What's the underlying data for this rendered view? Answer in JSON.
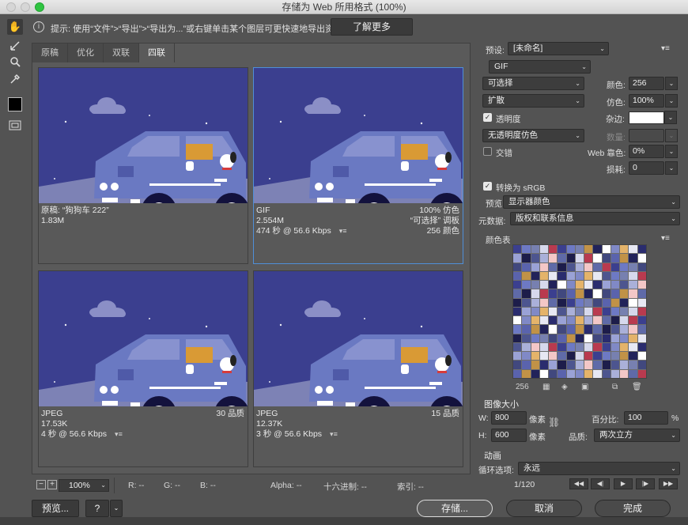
{
  "window": {
    "title": "存储为 Web 所用格式 (100%)"
  },
  "tools": [
    {
      "icon": "hand-icon"
    },
    {
      "icon": "slice-select-icon"
    },
    {
      "icon": "zoom-icon"
    },
    {
      "icon": "eyedropper-icon"
    },
    {
      "icon": "eyedropper-color-swatch"
    },
    {
      "icon": "toggle-slices-icon"
    }
  ],
  "hint": {
    "text": "提示: 使用“文件”>“导出”>“导出为...”或右键单击某个图层可更快速地导出资源",
    "learn_more": "了解更多"
  },
  "tabs": [
    "原稿",
    "优化",
    "双联",
    "四联"
  ],
  "active_tab": "四联",
  "panes": [
    {
      "left": "原稿: “狗狗车 222”",
      "left2": "1.83M",
      "left3": "",
      "right": "",
      "right2": "",
      "right3": ""
    },
    {
      "left": "GIF",
      "left2": "2.554M",
      "left3": "474 秒 @ 56.6 Kbps",
      "right": "100% 仿色",
      "right2": "“可选择” 调板",
      "right3": "256 颜色"
    },
    {
      "left": "JPEG",
      "left2": "17.53K",
      "left3": "4 秒 @ 56.6 Kbps",
      "right": "30 品质",
      "right2": "",
      "right3": ""
    },
    {
      "left": "JPEG",
      "left2": "12.37K",
      "left3": "3 秒 @ 56.6 Kbps",
      "right": "15 品质",
      "right2": "",
      "right3": ""
    }
  ],
  "status": {
    "zoom": "100%",
    "r": "R: --",
    "g": "G: --",
    "b": "B: --",
    "alpha": "Alpha: --",
    "hex": "十六进制: --",
    "index": "索引: --"
  },
  "settings": {
    "preset_label": "预设:",
    "preset_value": "[未命名]",
    "format": "GIF",
    "reduction": "可选择",
    "colors_label": "颜色:",
    "colors_value": "256",
    "dither_method": "扩散",
    "dither_label": "仿色:",
    "dither_value": "100%",
    "transparency_label": "透明度",
    "transparency_checked": true,
    "matte_label": "杂边:",
    "matte_color": "#ffffff",
    "transparency_dither": "无透明度仿色",
    "amount_label": "数量:",
    "interlaced_label": "交错",
    "interlaced_checked": false,
    "websnap_label": "Web 靠色:",
    "websnap_value": "0%",
    "lossy_label": "损耗:",
    "lossy_value": "0",
    "srgb_label": "转换为 sRGB",
    "srgb_checked": true,
    "preview_label": "预览:",
    "preview_value": "显示器颜色",
    "metadata_label": "元数据:",
    "metadata_value": "版权和联系信息",
    "color_table_label": "颜色表",
    "color_count": "256",
    "image_size_label": "图像大小",
    "w_label": "W:",
    "w_value": "800",
    "h_label": "H:",
    "h_value": "600",
    "px_unit": "像素",
    "percent_label": "百分比:",
    "percent_value": "100",
    "percent_unit": "%",
    "quality_label": "品质:",
    "quality_value": "两次立方",
    "animation_label": "动画",
    "loop_label": "循环选项:",
    "loop_value": "永远",
    "frame_counter": "1/120"
  },
  "buttons": {
    "preview": "预览...",
    "save": "存储...",
    "cancel": "取消",
    "done": "完成"
  },
  "colors": {
    "sky": "#3b3f8f",
    "car": "#6a79c2",
    "car_dark": "#4f5aa8",
    "window": "#8892cf",
    "dog_window": "#d99a35",
    "ground": "#b4b9d6",
    "cloud": "#8b8fc6",
    "selected_border": "#4f8fd8"
  }
}
